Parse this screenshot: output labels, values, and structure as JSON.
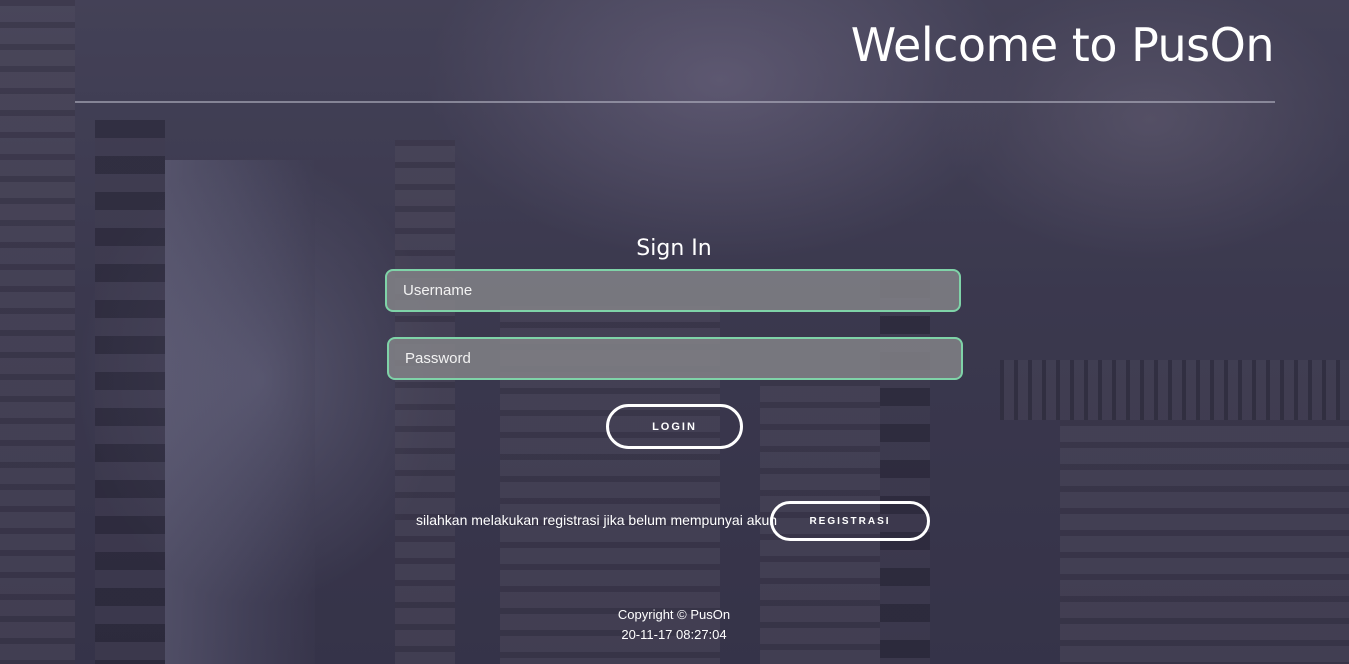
{
  "header": {
    "title": "Welcome to PusOn"
  },
  "signin": {
    "title": "Sign In",
    "username_placeholder": "Username",
    "password_placeholder": "Password",
    "login_label": "LOGIN"
  },
  "registration": {
    "prompt": "silahkan melakukan registrasi jika belum mempunyai akun",
    "button_label": "REGISTRASI"
  },
  "footer": {
    "copyright": "Copyright © PusOn",
    "timestamp": "20-11-17 08:27:04"
  },
  "colors": {
    "field_border": "#7fd3a8",
    "text": "#ffffff"
  }
}
